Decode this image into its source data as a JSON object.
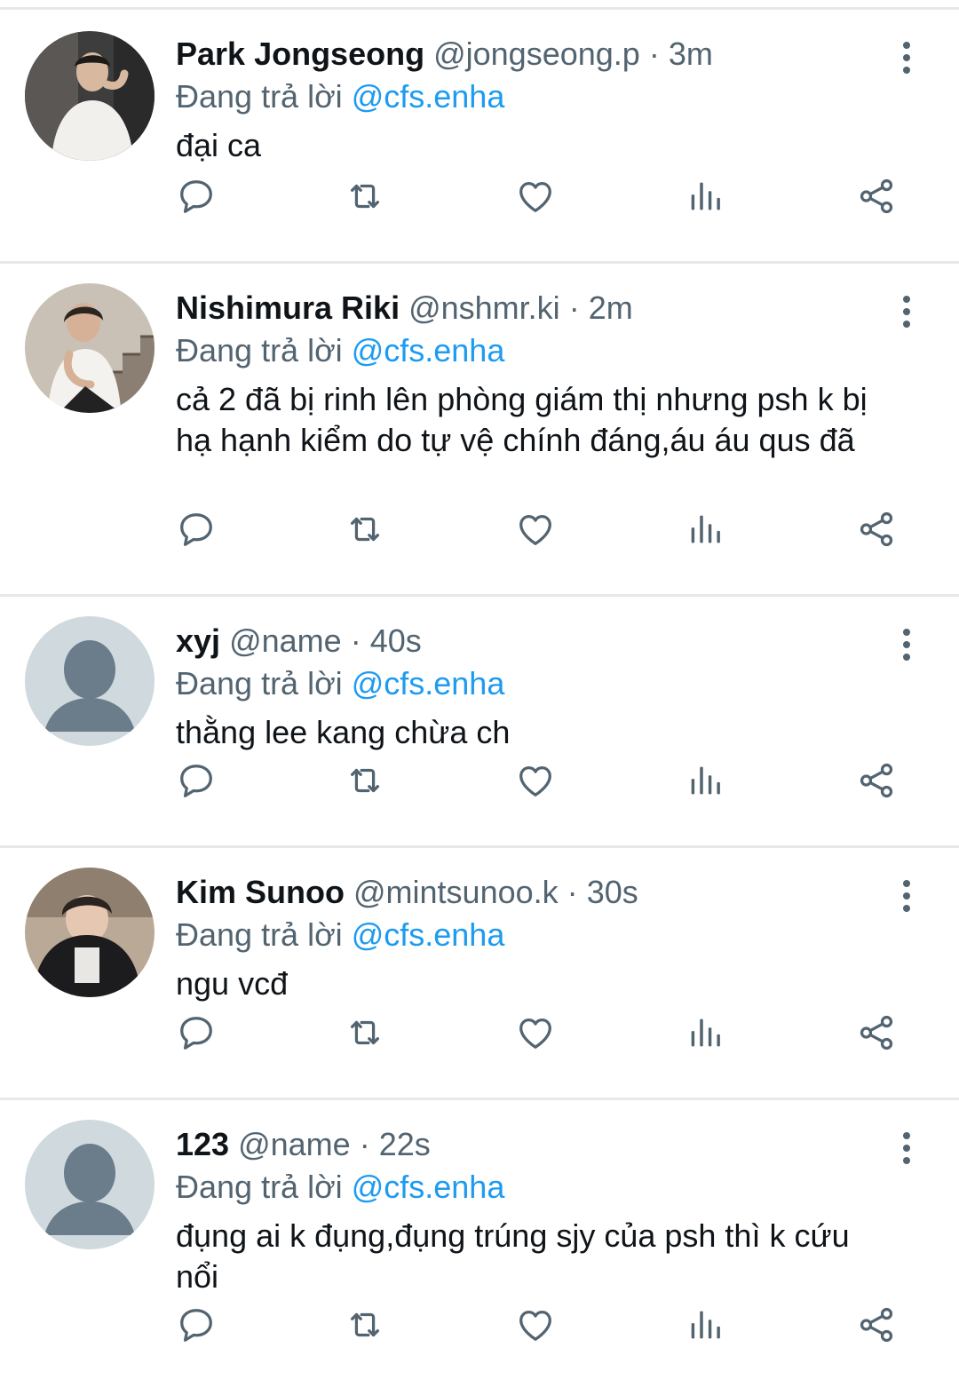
{
  "colors": {
    "mention": "#1d9bf0",
    "muted": "#536471",
    "divider": "#e6e9ec",
    "text": "#0f1419"
  },
  "icons": [
    "reply-icon",
    "retweet-icon",
    "like-icon",
    "views-icon",
    "share-icon",
    "more-icon"
  ],
  "tweets": [
    {
      "name": "Park Jongseong",
      "handle": "@jongseong.p",
      "sep": "·",
      "time": "3m",
      "replying_label": "Đang trả lời",
      "reply_to": "@cfs.enha",
      "text": "đại ca",
      "avatar": "photo"
    },
    {
      "name": "Nishimura Riki",
      "handle": "@nshmr.ki",
      "sep": "·",
      "time": "2m",
      "replying_label": "Đang trả lời",
      "reply_to": "@cfs.enha",
      "text": "cả 2 đã bị rinh lên phòng giám thị nhưng psh k bị hạ hạnh kiểm do tự vệ chính đáng,áu áu qus đã",
      "avatar": "photo"
    },
    {
      "name": "xyj",
      "handle": "@name",
      "sep": "·",
      "time": "40s",
      "replying_label": "Đang trả lời",
      "reply_to": "@cfs.enha",
      "text": "thằng lee kang chừa ch",
      "avatar": "default"
    },
    {
      "name": "Kim Sunoo",
      "handle": "@mintsunoo.k",
      "sep": "·",
      "time": "30s",
      "replying_label": "Đang trả lời",
      "reply_to": "@cfs.enha",
      "text": "ngu vcđ",
      "avatar": "photo"
    },
    {
      "name": "123",
      "handle": "@name",
      "sep": "·",
      "time": "22s",
      "replying_label": "Đang trả lời",
      "reply_to": "@cfs.enha",
      "text": "đụng ai k đụng,đụng trúng sjy của psh thì k cứu nổi",
      "avatar": "default"
    }
  ]
}
